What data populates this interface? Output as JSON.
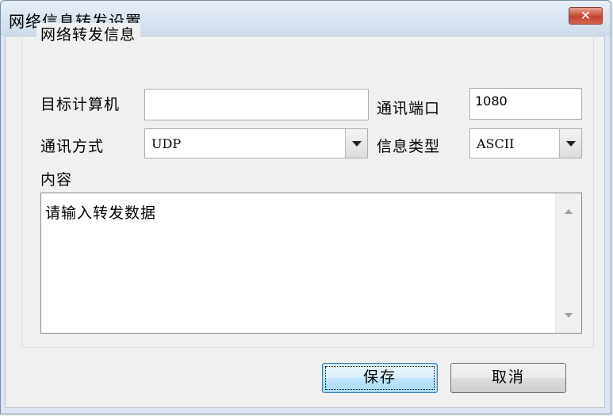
{
  "window": {
    "title": "网络信息转发设置",
    "close_glyph": "✕"
  },
  "group": {
    "legend": "网络转发信息"
  },
  "fields": {
    "target_label": "目标计算机",
    "target_value": "",
    "port_label": "通讯端口",
    "port_value": "1080",
    "mode_label": "通讯方式",
    "mode_value": "UDP",
    "info_type_label": "信息类型",
    "info_type_value": "ASCII",
    "content_label": "内容",
    "content_value": "请输入转发数据"
  },
  "buttons": {
    "save": "保存",
    "cancel": "取消"
  },
  "colors": {
    "close_button": "#c4432c",
    "default_button_border": "#3c7fb1",
    "window_frame": "#dbe6f2"
  },
  "icons": {
    "close": "close-icon",
    "dropdown": "chevron-down-icon",
    "scroll_up": "scroll-up-arrow-icon",
    "scroll_down": "scroll-down-arrow-icon"
  }
}
